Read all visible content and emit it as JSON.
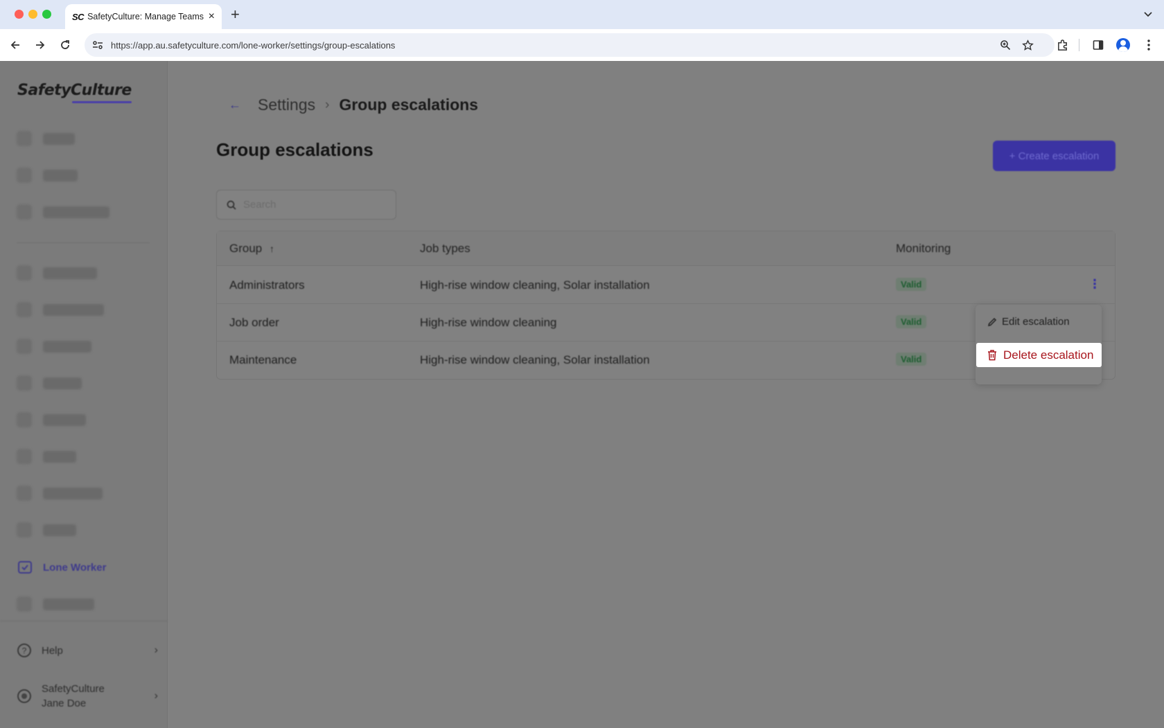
{
  "browser": {
    "tab_favicon": "SC",
    "tab_title": "SafetyCulture: Manage Teams and...",
    "url": "https://app.au.safetyculture.com/lone-worker/settings/group-escalations"
  },
  "sidebar": {
    "logo": "SafetyCulture",
    "active_item": "Lone Worker",
    "help_label": "Help",
    "account_org": "SafetyCulture",
    "account_user": "Jane Doe"
  },
  "breadcrumb": {
    "parent": "Settings",
    "current": "Group escalations"
  },
  "page": {
    "title": "Group escalations",
    "create_button": "+ Create escalation",
    "search_placeholder": "Search"
  },
  "table": {
    "headers": {
      "group": "Group",
      "job_types": "Job types",
      "monitoring": "Monitoring"
    },
    "rows": [
      {
        "group": "Administrators",
        "job_types": "High-rise window cleaning, Solar installation",
        "monitoring": "Valid"
      },
      {
        "group": "Job order",
        "job_types": "High-rise window cleaning",
        "monitoring": "Valid"
      },
      {
        "group": "Maintenance",
        "job_types": "High-rise window cleaning, Solar installation",
        "monitoring": "Valid"
      }
    ]
  },
  "menu": {
    "edit_label": "Edit escalation",
    "delete_label": "Delete escalation"
  },
  "colors": {
    "brand": "#3b33a3",
    "danger": "#a8151c",
    "success": "#1c5c2f"
  }
}
